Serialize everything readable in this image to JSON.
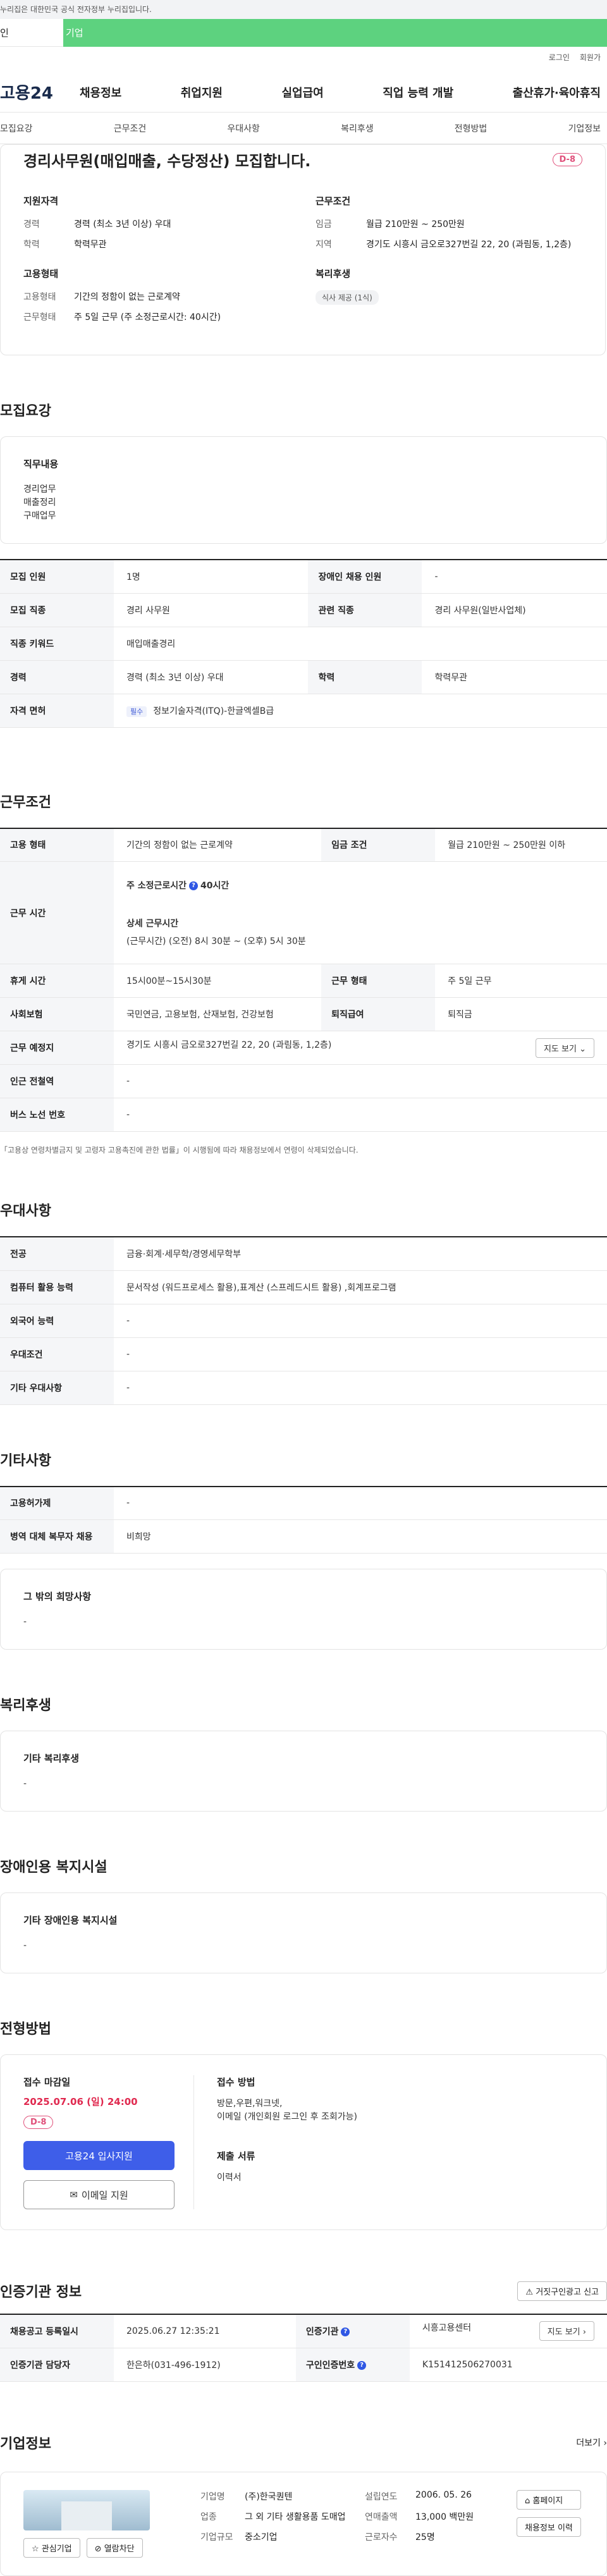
{
  "gov_banner": "누리집은 대한민국 공식 전자정부 누리집입니다.",
  "top_tabs": {
    "person": "인",
    "corp": "기업"
  },
  "util_links": [
    "로그인",
    "회원가"
  ],
  "logo": "고용24",
  "gnb": [
    "채용정보",
    "취업지원",
    "실업급여",
    "직업 능력 개발",
    "출산휴가·육아휴직"
  ],
  "anchor_nav": [
    "모집요강",
    "근무조건",
    "우대사항",
    "복리후생",
    "전형방법",
    "기업정보"
  ],
  "summary": {
    "title": "경리사무원(매입매출, 수당정산) 모집합니다.",
    "dday": "D-8",
    "qual_head": "지원자격",
    "career_key": "경력",
    "career_val": "경력 (최소 3년 이상) 우대",
    "edu_key": "학력",
    "edu_val": "학력무관",
    "emp_head": "고용형태",
    "emp_key": "고용형태",
    "emp_val": "기간의 정함이 없는 근로계약",
    "work_key": "근무형태",
    "work_val": "주 5일 근무 (주 소정근로시간: 40시간)",
    "cond_head": "근무조건",
    "wage_key": "임금",
    "wage_val": "월급 210만원 ~ 250만원",
    "area_key": "지역",
    "area_val": "경기도 시흥시 금오로327번길 22, 20 (과림동, 1,2층)",
    "welfare_head": "복리후생",
    "welfare_chip": "식사 제공 (1식)"
  },
  "recruit": {
    "section": "모집요강",
    "duty_head": "직무내용",
    "duty_text": "경리업무\n매출정리\n구매업무",
    "table": {
      "count_k": "모집 인원",
      "count_v": "1명",
      "disabled_k": "장애인 채용 인원",
      "disabled_v": "-",
      "job_k": "모집 직종",
      "job_v": "경리 사무원",
      "related_k": "관련 직종",
      "related_v": "경리 사무원(일반사업체)",
      "kw_k": "직종 키워드",
      "kw_v": "매입매출경리",
      "career_k": "경력",
      "career_v": "경력 (최소 3년 이상) 우대",
      "edu_k": "학력",
      "edu_v": "학력무관",
      "license_k": "자격 면허",
      "license_chip": "필수",
      "license_v": "정보기술자격(ITQ)-한글엑셀B급"
    }
  },
  "conditions": {
    "section": "근무조건",
    "type_k": "고용 형태",
    "type_v": "기간의 정함이 없는 근로계약",
    "wage_k": "임금 조건",
    "wage_v": "월급 210만원 ~ 250만원 이하",
    "time_k": "근무 시간",
    "weekly_label": "주 소정근로시간",
    "weekly_val": "40시간",
    "detail_label": "상세 근무시간",
    "detail_val": "(근무시간) (오전) 8시 30분 ~ (오후) 5시 30분",
    "rest_k": "휴게 시간",
    "rest_v": "15시00분~15시30분",
    "form_k": "근무 형태",
    "form_v": "주 5일 근무",
    "ins_k": "사회보험",
    "ins_v": "국민연금, 고용보험, 산재보험, 건강보험",
    "sev_k": "퇴직급여",
    "sev_v": "퇴직금",
    "place_k": "근무 예정지",
    "place_v": "경기도 시흥시 금오로327번길 22, 20 (과림동, 1,2층)",
    "map_btn": "지도 보기",
    "subway_k": "인근 전철역",
    "subway_v": "-",
    "bus_k": "버스 노선 번호",
    "bus_v": "-",
    "footnote": "「고용상 연령차별금지 및 고령자 고용촉진에 관한 법률」이 시행됨에 따라 채용정보에서 연령이 삭제되었습니다."
  },
  "preferred": {
    "section": "우대사항",
    "major_k": "전공",
    "major_v": "금융·회계·세무학/경영세무학부",
    "pc_k": "컴퓨터 활용 능력",
    "pc_v": "문서작성 (워드프로세스 활용),표계산 (스프레드시트 활용) ,회계프로그램",
    "lang_k": "외국어 능력",
    "lang_v": "-",
    "cond_k": "우대조건",
    "cond_v": "-",
    "etc_k": "기타 우대사항",
    "etc_v": "-"
  },
  "other": {
    "section": "기타사항",
    "permit_k": "고용허가제",
    "permit_v": "-",
    "military_k": "병역 대체 복무자 채용",
    "military_v": "비희망",
    "wish_head": "그 밖의 희망사항",
    "wish_text": "-"
  },
  "welfare": {
    "section": "복리후생",
    "head": "기타 복리후생",
    "text": "-"
  },
  "disabled_facility": {
    "section": "장애인용 복지시설",
    "head": "기타 장애인용 복지시설",
    "text": "-"
  },
  "process": {
    "section": "전형방법",
    "deadline_label": "접수 마감일",
    "deadline": "2025.07.06 (일) 24:00",
    "dday": "D-8",
    "apply_btn": "고용24 입사지원",
    "email_btn": "이메일 지원",
    "method_label": "접수 방법",
    "method_text": "방문,우편,워크넷,\n이메일 (개인회원 로그인 후 조회가능)",
    "docs_label": "제출 서류",
    "docs_text": "이력서"
  },
  "cert": {
    "section": "인증기관 정보",
    "report_btn": "거짓구인광고 신고",
    "reg_k": "채용공고 등록일시",
    "reg_v": "2025.06.27 12:35:21",
    "org_k": "인증기관",
    "org_v": "시흥고용센터",
    "map_btn": "지도 보기",
    "staff_k": "인증기관 담당자",
    "staff_v": "한은하(031-496-1912)",
    "num_k": "구인인증번호",
    "num_v": "K151412506270031"
  },
  "company": {
    "section": "기업정보",
    "more": "더보기",
    "interest_btn": "관심기업",
    "block_btn": "열람차단",
    "name_k": "기업명",
    "name_v": "(주)한국퀀텐",
    "industry_k": "업종",
    "industry_v": "그 외 기타 생활용품 도매업",
    "size_k": "기업규모",
    "size_v": "중소기업",
    "year_k": "설립연도",
    "year_v": "2006. 05. 26",
    "sales_k": "연매출액",
    "sales_v": "13,000 백만원",
    "emp_k": "근로자수",
    "emp_v": "25명",
    "home_btn": "홈페이지",
    "history_btn": "채용정보 이력"
  }
}
